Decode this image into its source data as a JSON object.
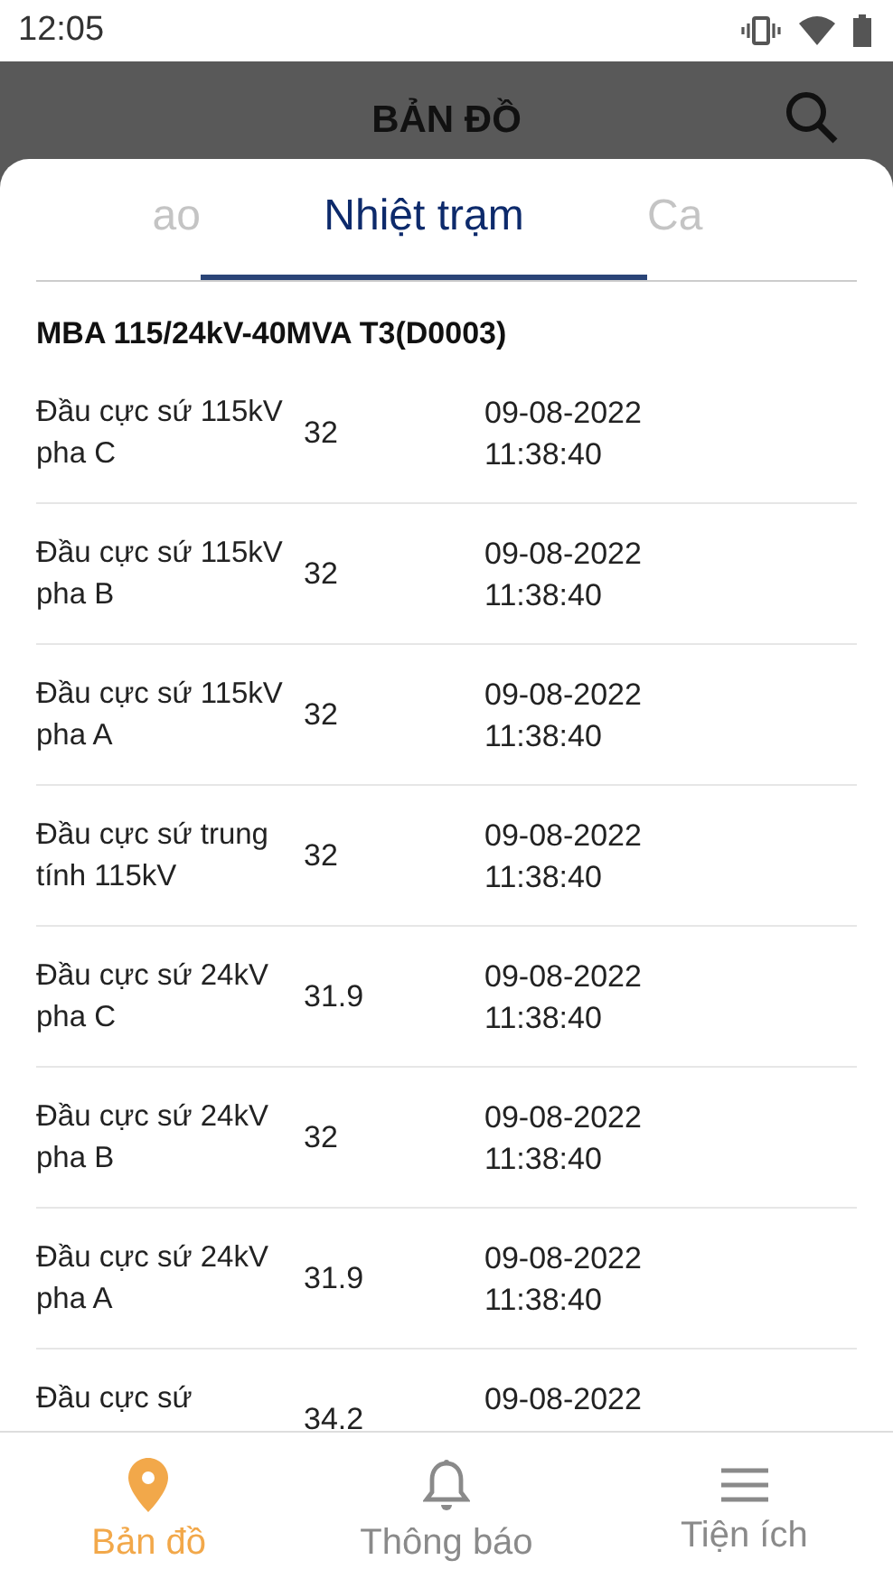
{
  "status_bar": {
    "time": "12:05"
  },
  "header": {
    "title": "BẢN ĐỒ"
  },
  "tabs": [
    {
      "label": "ao",
      "selected": false
    },
    {
      "label": "Nhiệt trạm",
      "selected": true
    },
    {
      "label": "Ca",
      "selected": false
    }
  ],
  "device": {
    "title": "MBA 115/24kV-40MVA T3(D0003)"
  },
  "readings": [
    {
      "name": "Đầu cực sứ 115kV pha C",
      "value": "32",
      "date": "09-08-2022",
      "time": "11:38:40"
    },
    {
      "name": "Đầu cực sứ 115kV pha B",
      "value": "32",
      "date": "09-08-2022",
      "time": "11:38:40"
    },
    {
      "name": "Đầu cực sứ 115kV pha A",
      "value": "32",
      "date": "09-08-2022",
      "time": "11:38:40"
    },
    {
      "name": "Đầu cực sứ trung tính 115kV",
      "value": "32",
      "date": "09-08-2022",
      "time": "11:38:40"
    },
    {
      "name": "Đầu cực sứ 24kV pha C",
      "value": "31.9",
      "date": "09-08-2022",
      "time": "11:38:40"
    },
    {
      "name": "Đầu cực sứ 24kV pha B",
      "value": "32",
      "date": "09-08-2022",
      "time": "11:38:40"
    },
    {
      "name": "Đầu cực sứ 24kV pha A",
      "value": "31.9",
      "date": "09-08-2022",
      "time": "11:38:40"
    },
    {
      "name": "Đầu cực sứ",
      "value": "34.2",
      "date": "09-08-2022"
    }
  ],
  "bottom_nav": [
    {
      "label": "Bản đồ",
      "selected": true,
      "kind": "map"
    },
    {
      "label": "Thông báo",
      "selected": false,
      "kind": "bell"
    },
    {
      "label": "Tiện ích",
      "selected": false,
      "kind": "menu"
    }
  ]
}
